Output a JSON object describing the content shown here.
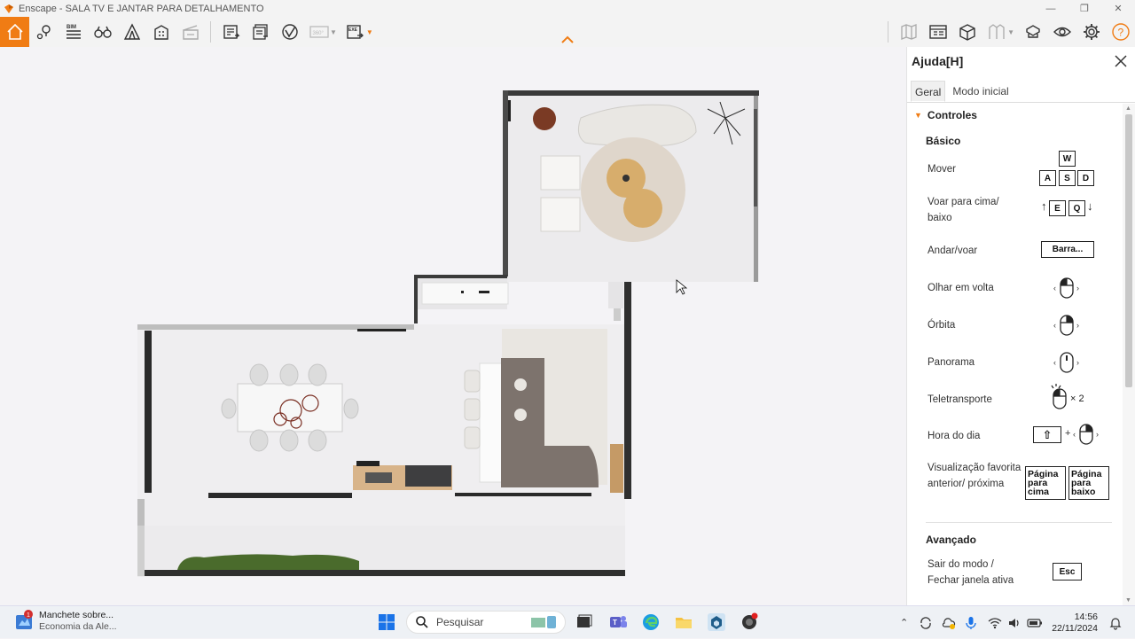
{
  "window": {
    "title": "Enscape - SALA TV E JANTAR PARA DETALHAMENTO"
  },
  "toolbar": {
    "left_icons": [
      "home-icon",
      "location-pin-icon",
      "bim-icon",
      "binoculars-icon",
      "tent-icon",
      "building-icon",
      "clapper-icon",
      "screenshot-export-icon",
      "batch-export-icon",
      "vr-export-icon",
      "panorama-360-icon",
      "exe-export-icon"
    ],
    "bim_label": "BIM",
    "pano_label": "360°",
    "exe_label": "EXE",
    "right_icons": [
      "map-icon",
      "asset-library-icon",
      "cube-icon",
      "views-icon",
      "material-icon",
      "eye-icon",
      "gear-icon",
      "help-icon"
    ]
  },
  "help_panel": {
    "title": "Ajuda[H]",
    "tabs": [
      {
        "label": "Geral",
        "active": true
      },
      {
        "label": "Modo inicial",
        "active": false
      }
    ],
    "section_controls": "Controles",
    "subsection_basic": "Básico",
    "rows": [
      {
        "label": "Mover",
        "keys": [
          "W",
          "A",
          "S",
          "D"
        ]
      },
      {
        "label": "Voar para cima/ baixo",
        "keys": [
          "E",
          "Q"
        ]
      },
      {
        "label": "Andar/voar",
        "keys": [
          "Barra..."
        ]
      },
      {
        "label": "Olhar em volta",
        "icon": "mouse-left-icon"
      },
      {
        "label": "Órbita",
        "icon": "mouse-right-icon"
      },
      {
        "label": "Panorama",
        "icon": "mouse-middle-icon"
      },
      {
        "label": "Teletransporte",
        "icon": "mouse-double-click-icon",
        "suffix": "× 2"
      },
      {
        "label": "Hora do dia",
        "keys": [
          "⇧"
        ],
        "plus": "+",
        "icon": "mouse-right-icon"
      },
      {
        "label": "Visualização favorita anterior/ próxima",
        "keys": [
          "Página para cima",
          "Página para baixo"
        ]
      }
    ],
    "subsection_advanced": "Avançado",
    "advanced_rows": [
      {
        "label": "Sair do modo / Fechar janela ativa",
        "keys": [
          "Esc"
        ]
      }
    ]
  },
  "taskbar": {
    "news_badge": "1",
    "news_title": "Manchete sobre...",
    "news_subtitle": "Economia da Ale...",
    "search_placeholder": "Pesquisar",
    "time": "14:56",
    "date": "22/11/2024"
  },
  "colors": {
    "accent": "#f07c14",
    "panel_bg": "#ffffff",
    "viewport_bg": "#f4f3f6"
  }
}
